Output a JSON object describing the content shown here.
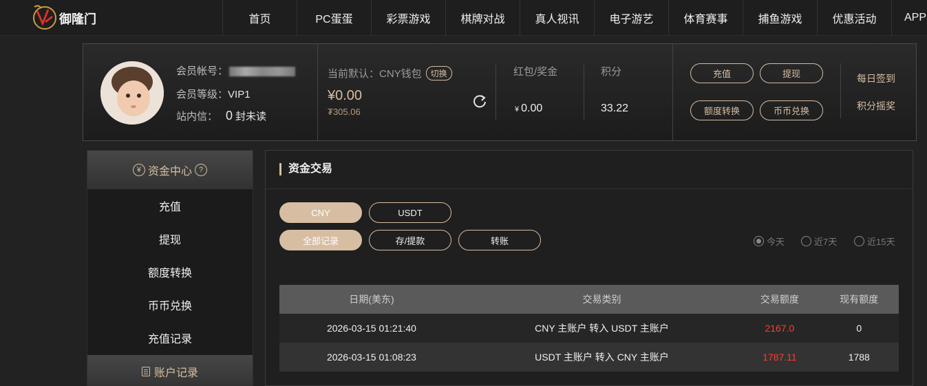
{
  "nav": {
    "logo_text": "御隆门",
    "items": [
      "首页",
      "PC蛋蛋",
      "彩票游戏",
      "棋牌对战",
      "真人视讯",
      "电子游艺",
      "体育赛事",
      "捕鱼游戏",
      "优惠活动",
      "APP"
    ]
  },
  "user": {
    "account_label": "会员帐号：",
    "level_label": "会员等级：",
    "level_value": "VIP1",
    "inbox_label": "站内信：",
    "inbox_count": "0",
    "inbox_suffix": "封未读"
  },
  "wallet": {
    "label": "当前默认：CNY钱包",
    "switch_label": "切换",
    "amount": "¥0.00",
    "sub_amount": "₮305.06"
  },
  "stats": {
    "bonus_label": "红包/奖金",
    "bonus_currency": "¥",
    "bonus_value": "0.00",
    "points_label": "积分",
    "points_value": "33.22"
  },
  "actions": {
    "deposit": "充值",
    "withdraw": "提现",
    "transfer": "额度转换",
    "exchange": "币币兑换",
    "daily_checkin": "每日签到",
    "points_lottery": "积分摇奖"
  },
  "sidebar": {
    "head": "资金中心",
    "items": [
      "充值",
      "提现",
      "额度转换",
      "币币兑换",
      "充值记录"
    ],
    "head2": "账户记录"
  },
  "main": {
    "title": "资金交易",
    "currency_tabs": [
      "CNY",
      "USDT"
    ],
    "type_tabs": [
      "全部记录",
      "存/提款",
      "转账"
    ],
    "date_filters": [
      "今天",
      "近7天",
      "近15天"
    ],
    "columns": [
      "日期(美东)",
      "交易类别",
      "交易额度",
      "现有额度"
    ],
    "rows": [
      {
        "date": "2026-03-15 01:21:40",
        "type": "CNY 主账户 转入 USDT 主账户",
        "amount": "2167.0",
        "balance": "0"
      },
      {
        "date": "2026-03-15 01:08:23",
        "type": "USDT 主账户 转入 CNY 主账户",
        "amount": "1787.11",
        "balance": "1788"
      }
    ]
  },
  "colors": {
    "accent": "#d7bea3",
    "amount_red": "#ff3b30",
    "bg": "#222222"
  }
}
